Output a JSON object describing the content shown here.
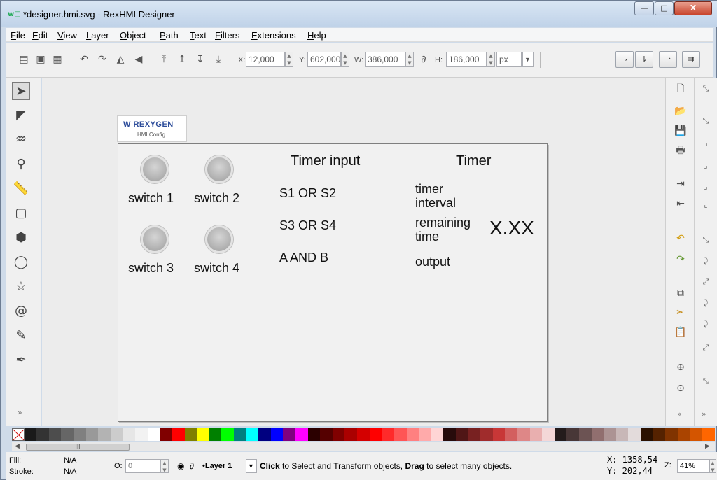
{
  "window": {
    "title": "*designer.hmi.svg - RexHMI Designer",
    "min_label": "—",
    "max_label": "□",
    "close_label": "X"
  },
  "menubar": {
    "items": [
      "File",
      "Edit",
      "View",
      "Layer",
      "Object",
      "Path",
      "Text",
      "Filters",
      "Extensions",
      "Help"
    ]
  },
  "toolbar": {
    "x_label": "X:",
    "x_value": "12,000",
    "y_label": "Y:",
    "y_value": "602,000",
    "w_label": "W:",
    "w_value": "386,000",
    "h_label": "H:",
    "h_value": "186,000",
    "unit": "px"
  },
  "canvas": {
    "logo": {
      "brand": "REXYGEN",
      "subtitle": "HMI Config"
    },
    "switches": [
      {
        "label": "switch 1"
      },
      {
        "label": "switch 2"
      },
      {
        "label": "switch 3"
      },
      {
        "label": "switch 4"
      }
    ],
    "timer_input": {
      "heading": "Timer input",
      "lines": [
        "S1 OR S2",
        "S3 OR S4",
        "A AND B"
      ]
    },
    "timer": {
      "heading": "Timer",
      "interval": "timer\ninterval",
      "remaining": "remaining\ntime",
      "value": "X.XX",
      "output": "output"
    }
  },
  "palette": {
    "colors": [
      "#000000",
      "#1a1a1a",
      "#333333",
      "#4d4d4d",
      "#666666",
      "#808080",
      "#999999",
      "#b3b3b3",
      "#cccccc",
      "#e6e6e6",
      "#f2f2f2",
      "#ffffff",
      "#800000",
      "#ff0000",
      "#808000",
      "#ffff00",
      "#008000",
      "#00ff00",
      "#008080",
      "#00ffff",
      "#000080",
      "#0000ff",
      "#800080",
      "#ff00ff",
      "#2b0000",
      "#550000",
      "#800000",
      "#aa0000",
      "#d40000",
      "#ff0000",
      "#ff2a2a",
      "#ff5555",
      "#ff8080",
      "#ffaaaa",
      "#ffd5d5",
      "#280b0b",
      "#501616",
      "#782121",
      "#a02c2c",
      "#c83737",
      "#d35f5f",
      "#de8787",
      "#e9afaf",
      "#f4d7d7",
      "#241c1c",
      "#483737",
      "#6c5353",
      "#916f6f",
      "#ac9393",
      "#c8b7b7",
      "#e3dbdb",
      "#2b1100",
      "#552200",
      "#803300",
      "#aa4400",
      "#d45500",
      "#ff6600"
    ]
  },
  "hscroll": {
    "thumb_grip": "III"
  },
  "statusbar": {
    "fill_label": "Fill:",
    "fill_value": "N/A",
    "stroke_label": "Stroke:",
    "stroke_value": "N/A",
    "opacity_label": "O:",
    "opacity_value": "0",
    "layer": "•Layer 1",
    "message_bold1": "Click",
    "message_mid": " to Select and Transform objects, ",
    "message_bold2": "Drag",
    "message_end": " to select many objects.",
    "cursor_x": "X: 1358,54",
    "cursor_y": "Y:  202,44",
    "zoom_label": "Z:",
    "zoom_value": "41%"
  },
  "chevron": "»"
}
